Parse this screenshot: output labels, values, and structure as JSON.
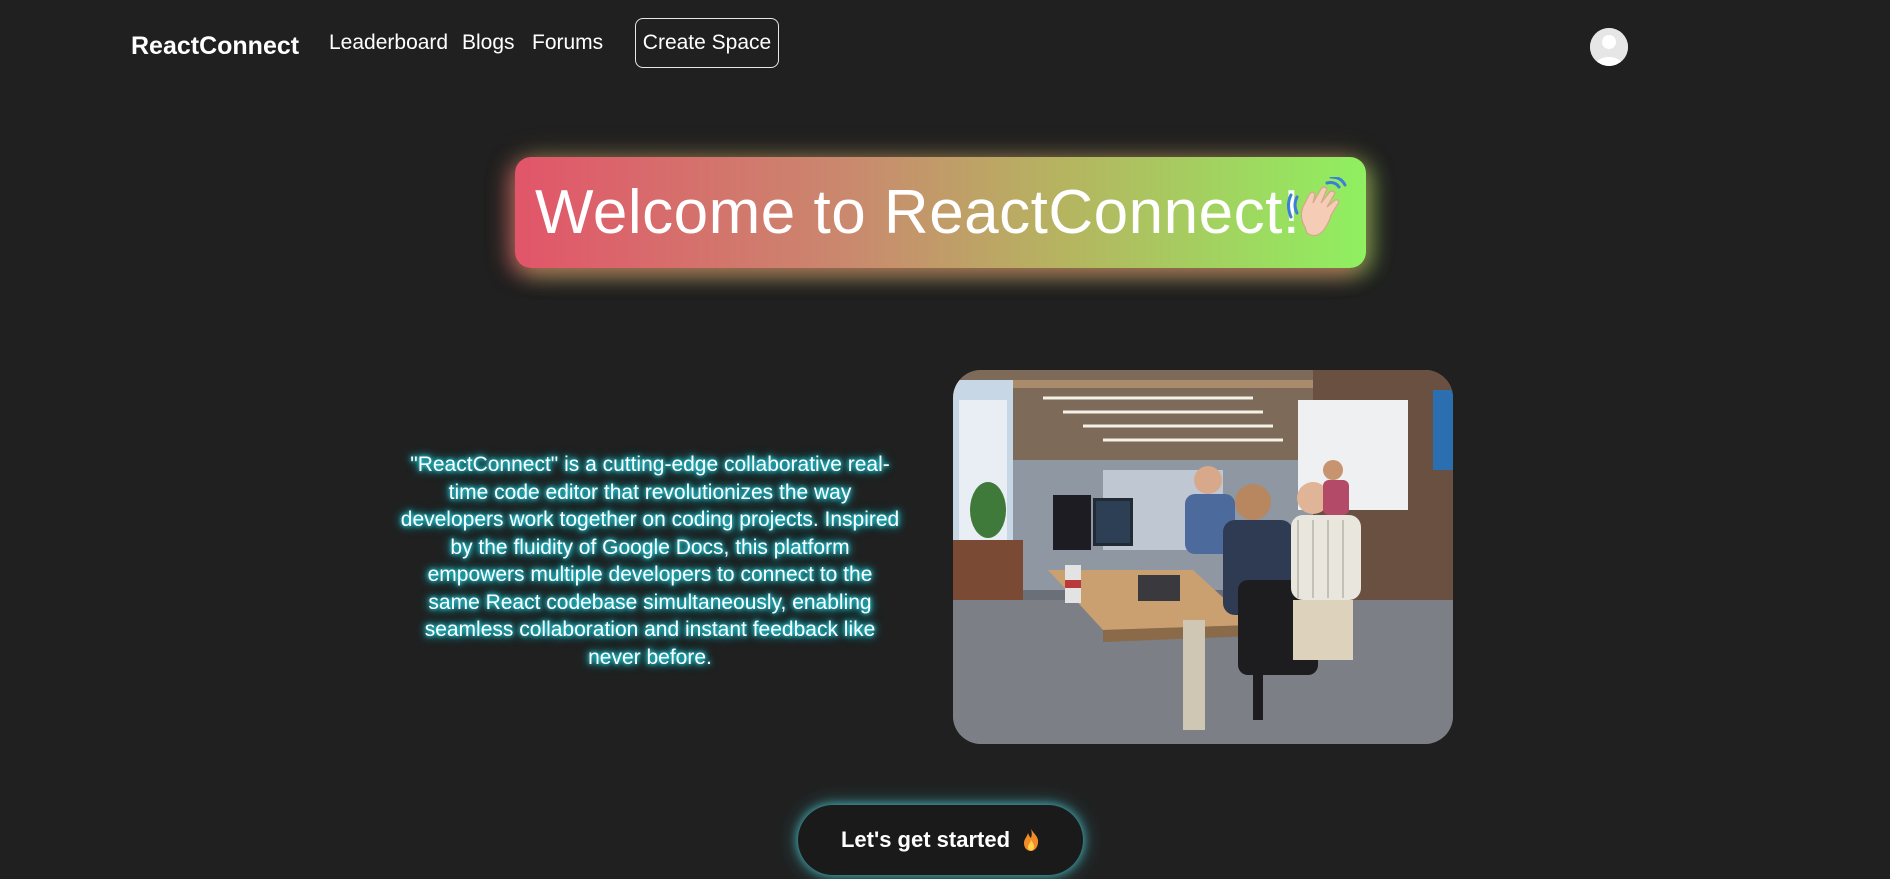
{
  "navbar": {
    "brand": "ReactConnect",
    "links": [
      {
        "label": "Leaderboard"
      },
      {
        "label": "Blogs"
      },
      {
        "label": "Forums"
      }
    ],
    "create_space_label": "Create Space",
    "avatar_icon": "user-avatar-icon"
  },
  "hero": {
    "title": "Welcome to ReactConnect!",
    "emoji_icon": "waving-hand-icon",
    "gradient_colors": [
      "#e2556a",
      "#8ff060"
    ]
  },
  "main": {
    "description": "\"ReactConnect\" is a cutting-edge collaborative real-time code editor that revolutionizes the way developers work together on coding projects. Inspired by the fluidity of Google Docs, this platform empowers multiple developers to connect to the same React codebase simultaneously, enabling seamless collaboration and instant feedback like never before.",
    "description_glow_color": "#2ef0ff",
    "image_subject": "developers collaborating in an open office"
  },
  "cta": {
    "label": "Let's get started",
    "icon": "fire-icon"
  },
  "colors": {
    "background": "#202020",
    "text": "#ffffff",
    "cta_glow": "#5adce1"
  }
}
